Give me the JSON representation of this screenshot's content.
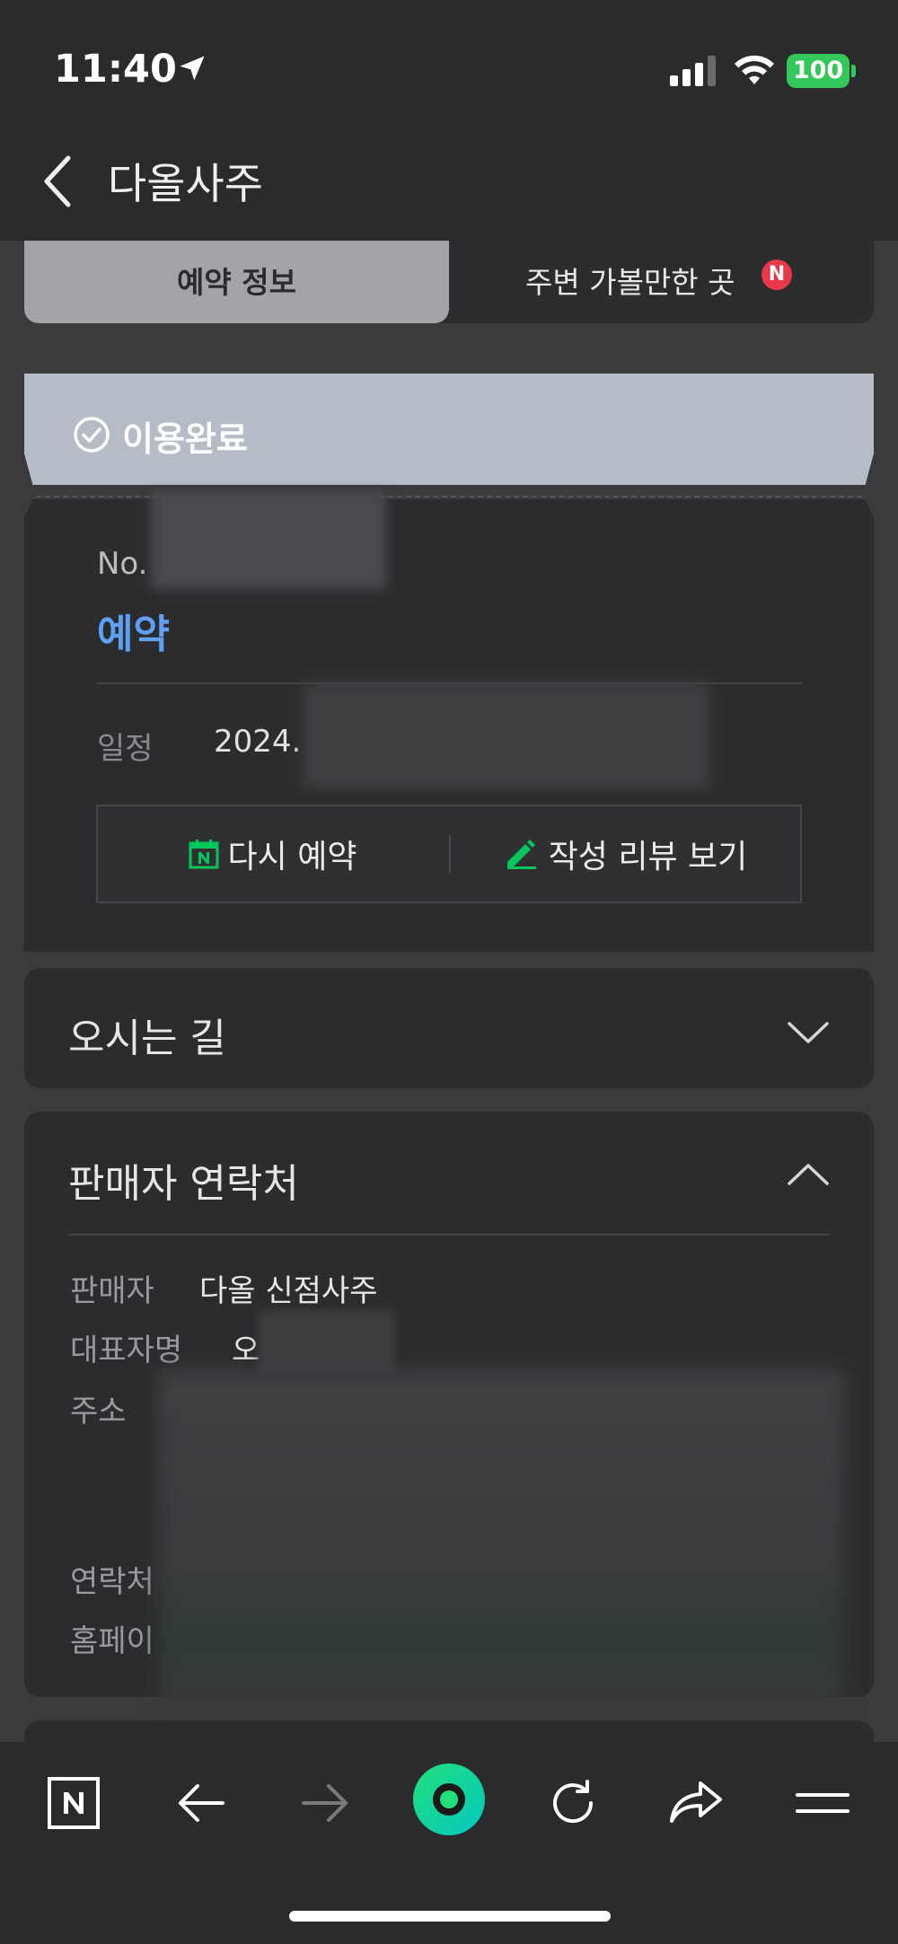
{
  "status_bar": {
    "time": "11:40",
    "battery": "100"
  },
  "header": {
    "title": "다올사주"
  },
  "tabs": [
    {
      "label": "예약 정보",
      "active": true
    },
    {
      "label": "주변 가볼만한 곳",
      "badge": "N"
    }
  ],
  "status_banner": {
    "label": "이용완료"
  },
  "reservation": {
    "no_label": "No.",
    "type": "예약",
    "date_label": "일정",
    "date_value": "2024.",
    "rebook_label": "다시 예약",
    "review_label": "작성 리뷰 보기"
  },
  "directions": {
    "title": "오시는 길"
  },
  "seller": {
    "title": "판매자 연락처",
    "seller_label": "판매자",
    "seller_value": "다올 신점사주",
    "rep_label": "대표자명",
    "rep_value": "오",
    "address_label": "주소",
    "contact_label": "연락처",
    "homepage_label": "홈페이"
  },
  "colors": {
    "accent_blue": "#5ea0f5",
    "naver_green": "#03c75a",
    "badge_red": "#e8394a",
    "banner": "#b6bcc6"
  },
  "icons": [
    "location-arrow-icon",
    "signal-icon",
    "wifi-icon",
    "back-chevron-icon",
    "check-circle-icon",
    "calendar-icon",
    "pencil-icon",
    "chevron-down-icon",
    "chevron-up-icon",
    "naver-home-icon",
    "back-arrow-icon",
    "forward-arrow-icon",
    "green-dot-icon",
    "refresh-icon",
    "share-icon",
    "menu-icon"
  ]
}
